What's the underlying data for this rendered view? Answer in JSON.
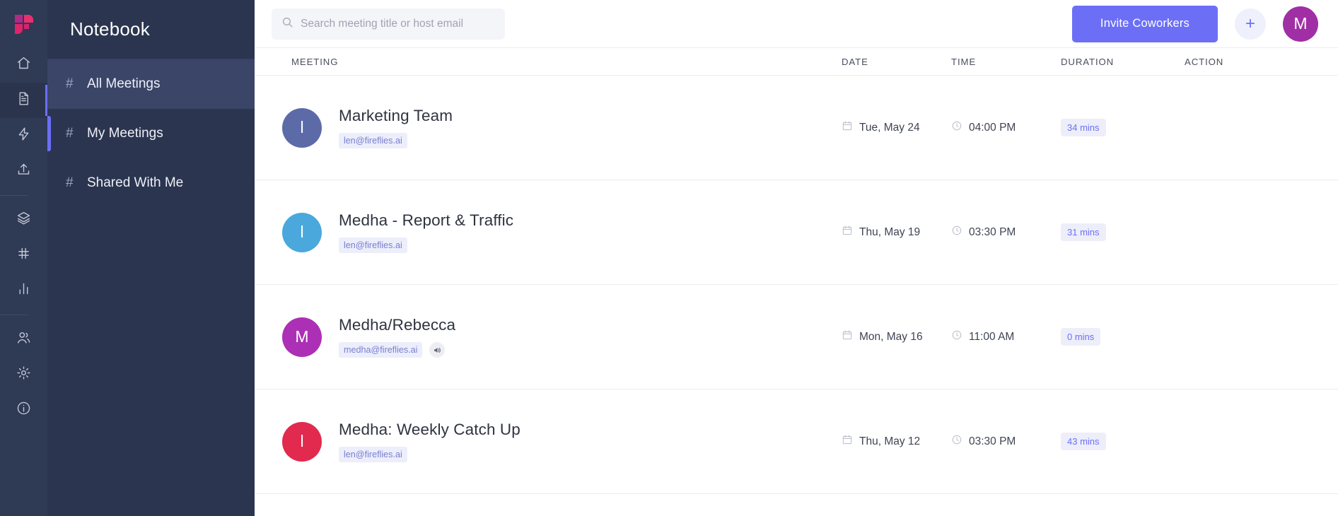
{
  "brand": {
    "logo_icon": "fireflies-logo-icon",
    "accent_color": "#6c6ff5",
    "rail_bg": "#2f3a55",
    "sidebar_bg": "#2b3550"
  },
  "rail": {
    "items": [
      {
        "icon": "home-icon",
        "active": false
      },
      {
        "icon": "document-icon",
        "active": true
      },
      {
        "icon": "lightning-bolt-icon",
        "active": false
      },
      {
        "icon": "upload-icon",
        "active": false
      },
      {
        "icon": "layers-icon",
        "active": false
      },
      {
        "icon": "hash-icon",
        "active": false
      },
      {
        "icon": "bar-chart-icon",
        "active": false
      },
      {
        "icon": "users-icon",
        "active": false
      },
      {
        "icon": "gear-icon",
        "active": false
      },
      {
        "icon": "info-icon",
        "active": false
      }
    ]
  },
  "sidebar": {
    "title": "Notebook",
    "items": [
      {
        "icon": "hash-icon",
        "hash": "#",
        "label": "All Meetings",
        "active": true,
        "selected": false
      },
      {
        "icon": "hash-icon",
        "hash": "#",
        "label": "My Meetings",
        "active": false,
        "selected": true
      },
      {
        "icon": "hash-icon",
        "hash": "#",
        "label": "Shared With Me",
        "active": false,
        "selected": false
      }
    ]
  },
  "topbar": {
    "search": {
      "icon": "search-icon",
      "placeholder": "Search meeting title or host email",
      "value": ""
    },
    "invite_label": "Invite Coworkers",
    "add_icon": "plus-icon",
    "add_label": "+",
    "avatar": {
      "initial": "M",
      "color": "#a02fa5"
    }
  },
  "table": {
    "columns": [
      "MEETING",
      "DATE",
      "TIME",
      "DURATION",
      "ACTION"
    ],
    "rows": [
      {
        "title": "Marketing Team",
        "email": "len@fireflies.ai",
        "avatar_initial": "l",
        "avatar_color": "#5c6ba8",
        "has_sound": false,
        "date": "Tue, May 24",
        "time": "04:00 PM",
        "duration": "34 mins"
      },
      {
        "title": "Medha - Report & Traffic",
        "email": "len@fireflies.ai",
        "avatar_initial": "l",
        "avatar_color": "#4aa8dd",
        "has_sound": false,
        "date": "Thu, May 19",
        "time": "03:30 PM",
        "duration": "31 mins"
      },
      {
        "title": "Medha/Rebecca",
        "email": "medha@fireflies.ai",
        "avatar_initial": "M",
        "avatar_color": "#ac30b5",
        "has_sound": true,
        "sound_icon": "speaker-icon",
        "date": "Mon, May 16",
        "time": "11:00 AM",
        "duration": "0 mins"
      },
      {
        "title": "Medha: Weekly Catch Up",
        "email": "len@fireflies.ai",
        "avatar_initial": "l",
        "avatar_color": "#e12a4d",
        "has_sound": false,
        "date": "Thu, May 12",
        "time": "03:30 PM",
        "duration": "43 mins"
      }
    ]
  }
}
